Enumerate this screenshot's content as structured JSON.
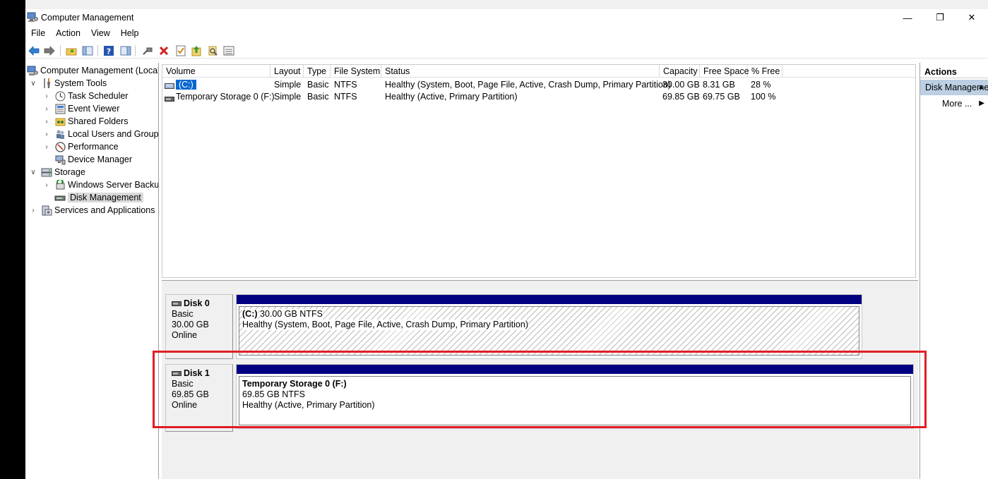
{
  "window": {
    "title": "Computer Management",
    "controls": {
      "minimize": "—",
      "restore": "❐",
      "close": "✕"
    }
  },
  "menu": [
    "File",
    "Action",
    "View",
    "Help"
  ],
  "tree": {
    "root": "Computer Management (Local",
    "system_tools": "System Tools",
    "task_scheduler": "Task Scheduler",
    "event_viewer": "Event Viewer",
    "shared_folders": "Shared Folders",
    "local_users": "Local Users and Groups",
    "performance": "Performance",
    "device_manager": "Device Manager",
    "storage": "Storage",
    "wsb": "Windows Server Backup",
    "disk_management": "Disk Management",
    "services": "Services and Applications"
  },
  "volumes": {
    "columns": [
      "Volume",
      "Layout",
      "Type",
      "File System",
      "Status",
      "Capacity",
      "Free Space",
      "% Free"
    ],
    "rows": [
      {
        "volume": "(C:)",
        "layout": "Simple",
        "type": "Basic",
        "fs": "NTFS",
        "status": "Healthy (System, Boot, Page File, Active, Crash Dump, Primary Partition)",
        "capacity": "30.00 GB",
        "free": "8.31 GB",
        "pct": "28 %"
      },
      {
        "volume": "Temporary Storage 0 (F:)",
        "layout": "Simple",
        "type": "Basic",
        "fs": "NTFS",
        "status": "Healthy (Active, Primary Partition)",
        "capacity": "69.85 GB",
        "free": "69.75 GB",
        "pct": "100 %"
      }
    ]
  },
  "disks": [
    {
      "name": "Disk 0",
      "type": "Basic",
      "size": "30.00 GB",
      "state": "Online",
      "partition": {
        "title": "(C:)",
        "size_fs": "30.00 GB NTFS",
        "status": "Healthy (System, Boot, Page File, Active, Crash Dump, Primary Partition)"
      }
    },
    {
      "name": "Disk 1",
      "type": "Basic",
      "size": "69.85 GB",
      "state": "Online",
      "partition": {
        "title": "Temporary Storage 0  (F:)",
        "size_fs": "69.85 GB NTFS",
        "status": "Healthy (Active, Primary Partition)"
      }
    }
  ],
  "actions": {
    "header": "Actions",
    "selected": "Disk Management",
    "more": "More ..."
  },
  "colors": {
    "disk_bar": "#000080",
    "highlight": "#e01e24",
    "selection": "#0a66d0",
    "actions_selected": "#bccfe3"
  }
}
